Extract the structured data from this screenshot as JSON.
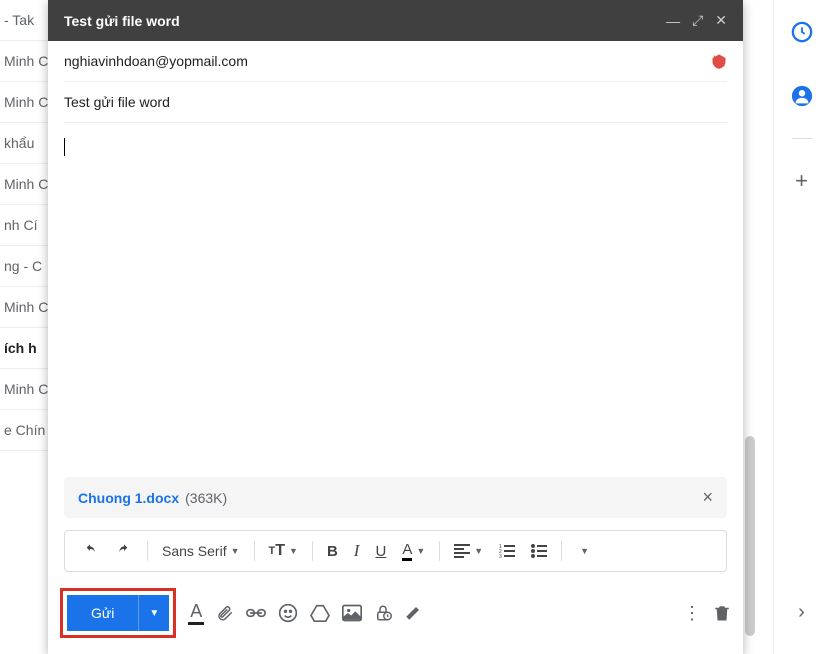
{
  "compose": {
    "title": "Test gửi file word",
    "to": "nghiavinhdoan@yopmail.com",
    "subject": "Test gửi file word",
    "body": ""
  },
  "attachment": {
    "name": "Chuong 1.docx",
    "size": "(363K)"
  },
  "format": {
    "font": "Sans Serif"
  },
  "actions": {
    "send": "Gửi"
  },
  "background_items": [
    {
      "text": "- Tak",
      "bold": false
    },
    {
      "text": "Minh Cí",
      "bold": false
    },
    {
      "text": "Minh Cí",
      "bold": false
    },
    {
      "text": "khẩu",
      "bold": false
    },
    {
      "text": "Minh Cí",
      "bold": false
    },
    {
      "text": "nh Cí",
      "bold": false
    },
    {
      "text": "ng - C",
      "bold": false
    },
    {
      "text": "Minh Cí",
      "bold": false
    },
    {
      "text": "ích h",
      "bold": true
    },
    {
      "text": "Minh Cí",
      "bold": false
    },
    {
      "text": "e Chín",
      "bold": false
    }
  ]
}
